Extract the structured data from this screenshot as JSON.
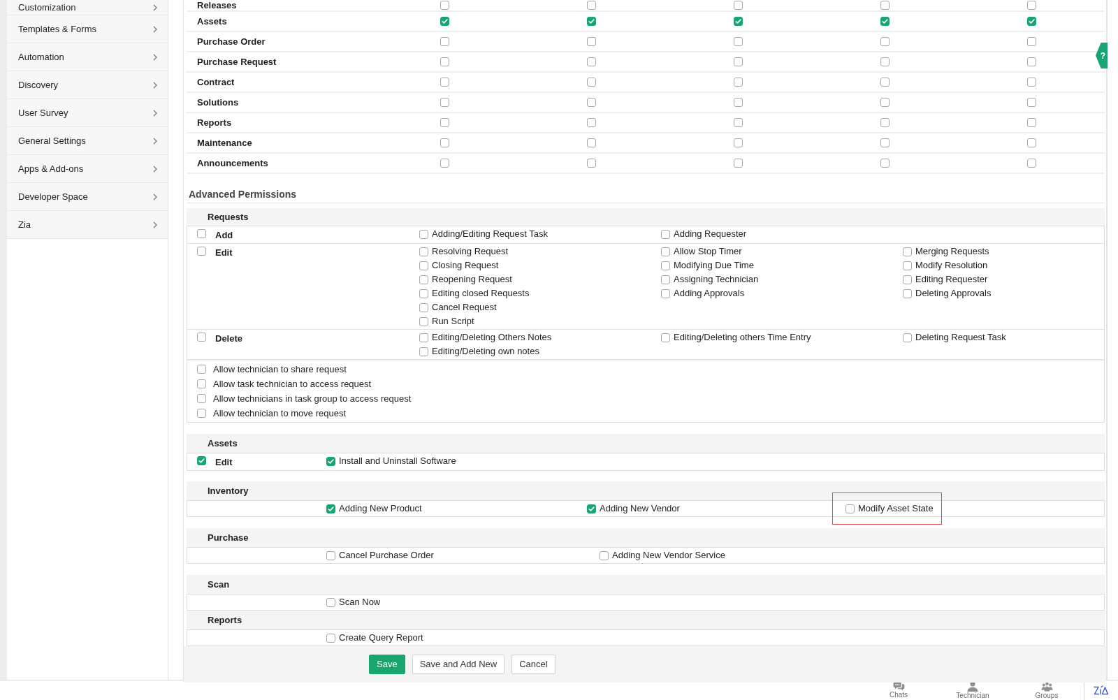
{
  "sidebar": {
    "items": [
      {
        "label": "Customization"
      },
      {
        "label": "Templates & Forms"
      },
      {
        "label": "Automation"
      },
      {
        "label": "Discovery"
      },
      {
        "label": "User Survey"
      },
      {
        "label": "General Settings"
      },
      {
        "label": "Apps & Add-ons"
      },
      {
        "label": "Developer Space"
      },
      {
        "label": "Zia"
      }
    ]
  },
  "help_tab": {
    "label": "?"
  },
  "permissions_table": {
    "rows": [
      {
        "label": "Releases",
        "cells": [
          {
            "checked": false
          },
          {
            "checked": false
          },
          {
            "checked": false
          },
          {
            "checked": false
          },
          {
            "checked": false
          }
        ]
      },
      {
        "label": "Assets",
        "cells": [
          {
            "checked": true
          },
          {
            "checked": true
          },
          {
            "checked": true
          },
          {
            "checked": true
          },
          {
            "checked": true
          }
        ]
      },
      {
        "label": "Purchase Order",
        "cells": [
          {
            "checked": false
          },
          {
            "checked": false
          },
          {
            "checked": false
          },
          {
            "checked": false
          },
          {
            "checked": false
          }
        ]
      },
      {
        "label": "Purchase Request",
        "cells": [
          {
            "checked": false
          },
          {
            "checked": false
          },
          {
            "checked": false
          },
          {
            "checked": false
          },
          {
            "checked": false
          }
        ]
      },
      {
        "label": "Contract",
        "cells": [
          {
            "checked": false
          },
          {
            "checked": false
          },
          {
            "checked": false
          },
          {
            "checked": false
          },
          {
            "checked": false
          }
        ]
      },
      {
        "label": "Solutions",
        "cells": [
          {
            "checked": false
          },
          {
            "checked": false
          },
          {
            "checked": false
          },
          {
            "checked": false
          },
          {
            "checked": false
          }
        ]
      },
      {
        "label": "Reports",
        "cells": [
          {
            "checked": false
          },
          {
            "checked": false
          },
          {
            "checked": false
          },
          {
            "checked": false
          },
          {
            "checked": false
          }
        ]
      },
      {
        "label": "Maintenance",
        "cells": [
          {
            "checked": false
          },
          {
            "checked": false
          },
          {
            "checked": false
          },
          {
            "checked": false
          },
          {
            "checked": false
          }
        ]
      },
      {
        "label": "Announcements",
        "cells": [
          {
            "checked": false
          },
          {
            "checked": false
          },
          {
            "checked": false
          },
          {
            "checked": false
          },
          {
            "checked": false
          }
        ]
      }
    ]
  },
  "advanced_permissions": {
    "title": "Advanced Permissions",
    "sections": [
      {
        "title": "Requests",
        "rows": [
          {
            "label": "Add",
            "checked": false,
            "columns": [
              {
                "options": [
                  {
                    "label": "Adding/Editing Request Task",
                    "checked": false
                  }
                ]
              },
              {
                "options": [
                  {
                    "label": "Adding Requester",
                    "checked": false
                  }
                ]
              }
            ]
          },
          {
            "label": "Edit",
            "checked": false,
            "columns": [
              {
                "options": [
                  {
                    "label": "Resolving Request",
                    "checked": false
                  },
                  {
                    "label": "Closing Request",
                    "checked": false
                  },
                  {
                    "label": "Reopening Request",
                    "checked": false
                  },
                  {
                    "label": "Editing closed Requests",
                    "checked": false
                  },
                  {
                    "label": "Cancel Request",
                    "checked": false
                  },
                  {
                    "label": "Run Script",
                    "checked": false
                  }
                ]
              },
              {
                "options": [
                  {
                    "label": "Allow Stop Timer",
                    "checked": false
                  },
                  {
                    "label": "Modifying Due Time",
                    "checked": false
                  },
                  {
                    "label": "Assigning Technician",
                    "checked": false
                  },
                  {
                    "label": "Adding Approvals",
                    "checked": false
                  }
                ]
              },
              {
                "options": [
                  {
                    "label": "Merging Requests",
                    "checked": false
                  },
                  {
                    "label": "Modify Resolution",
                    "checked": false
                  },
                  {
                    "label": "Editing Requester",
                    "checked": false
                  },
                  {
                    "label": "Deleting Approvals",
                    "checked": false
                  }
                ]
              }
            ]
          },
          {
            "label": "Delete",
            "checked": false,
            "columns": [
              {
                "options": [
                  {
                    "label": "Editing/Deleting Others Notes",
                    "checked": false
                  },
                  {
                    "label": "Editing/Deleting own notes",
                    "checked": false
                  }
                ]
              },
              {
                "options": [
                  {
                    "label": "Editing/Deleting others Time Entry",
                    "checked": false
                  }
                ]
              },
              {
                "options": [
                  {
                    "label": "Deleting Request Task",
                    "checked": false
                  }
                ]
              }
            ]
          }
        ],
        "extras": [
          {
            "label": "Allow technician to share request",
            "checked": false
          },
          {
            "label": "Allow task technician to access request",
            "checked": false
          },
          {
            "label": "Allow technicians in task group to access request",
            "checked": false
          },
          {
            "label": "Allow technician to move request",
            "checked": false
          }
        ]
      },
      {
        "title": "Assets",
        "rows": [
          {
            "label": "Edit",
            "checked": true,
            "columns": [
              {
                "options": [
                  {
                    "label": "Install and Uninstall Software",
                    "checked": true
                  }
                ]
              }
            ]
          }
        ]
      },
      {
        "title": "Inventory",
        "rows": [
          {
            "columns": [
              {
                "options": [
                  {
                    "label": "Adding New Product",
                    "checked": true,
                    "highlighted": false
                  }
                ]
              },
              {
                "options": [
                  {
                    "label": "Adding New Vendor",
                    "checked": true,
                    "highlighted": false
                  }
                ]
              },
              {
                "options": [
                  {
                    "label": "Modify Asset State",
                    "checked": false,
                    "highlighted": true
                  }
                ]
              }
            ]
          }
        ]
      },
      {
        "title": "Purchase",
        "rows": [
          {
            "columns": [
              {
                "options": [
                  {
                    "label": "Cancel Purchase Order",
                    "checked": false
                  }
                ]
              },
              {
                "options": [
                  {
                    "label": "Adding New Vendor Service",
                    "checked": false
                  }
                ]
              }
            ]
          }
        ]
      },
      {
        "title": "Scan",
        "rows": [
          {
            "columns": [
              {
                "options": [
                  {
                    "label": "Scan Now",
                    "checked": false
                  }
                ]
              }
            ]
          }
        ]
      },
      {
        "title": "Reports",
        "rows": [
          {
            "columns": [
              {
                "options": [
                  {
                    "label": "Create Query Report",
                    "checked": false
                  }
                ]
              }
            ]
          }
        ]
      }
    ]
  },
  "footer": {
    "buttons": [
      {
        "label": "Save",
        "kind": "primary"
      },
      {
        "label": "Save and Add New",
        "kind": "secondary"
      },
      {
        "label": "Cancel",
        "kind": "secondary"
      }
    ]
  },
  "bottom_bar": {
    "items": [
      {
        "label": "Chats",
        "kind": "chats"
      },
      {
        "label": "Technician",
        "kind": "technician"
      },
      {
        "label": "Groups",
        "kind": "groups"
      }
    ]
  }
}
